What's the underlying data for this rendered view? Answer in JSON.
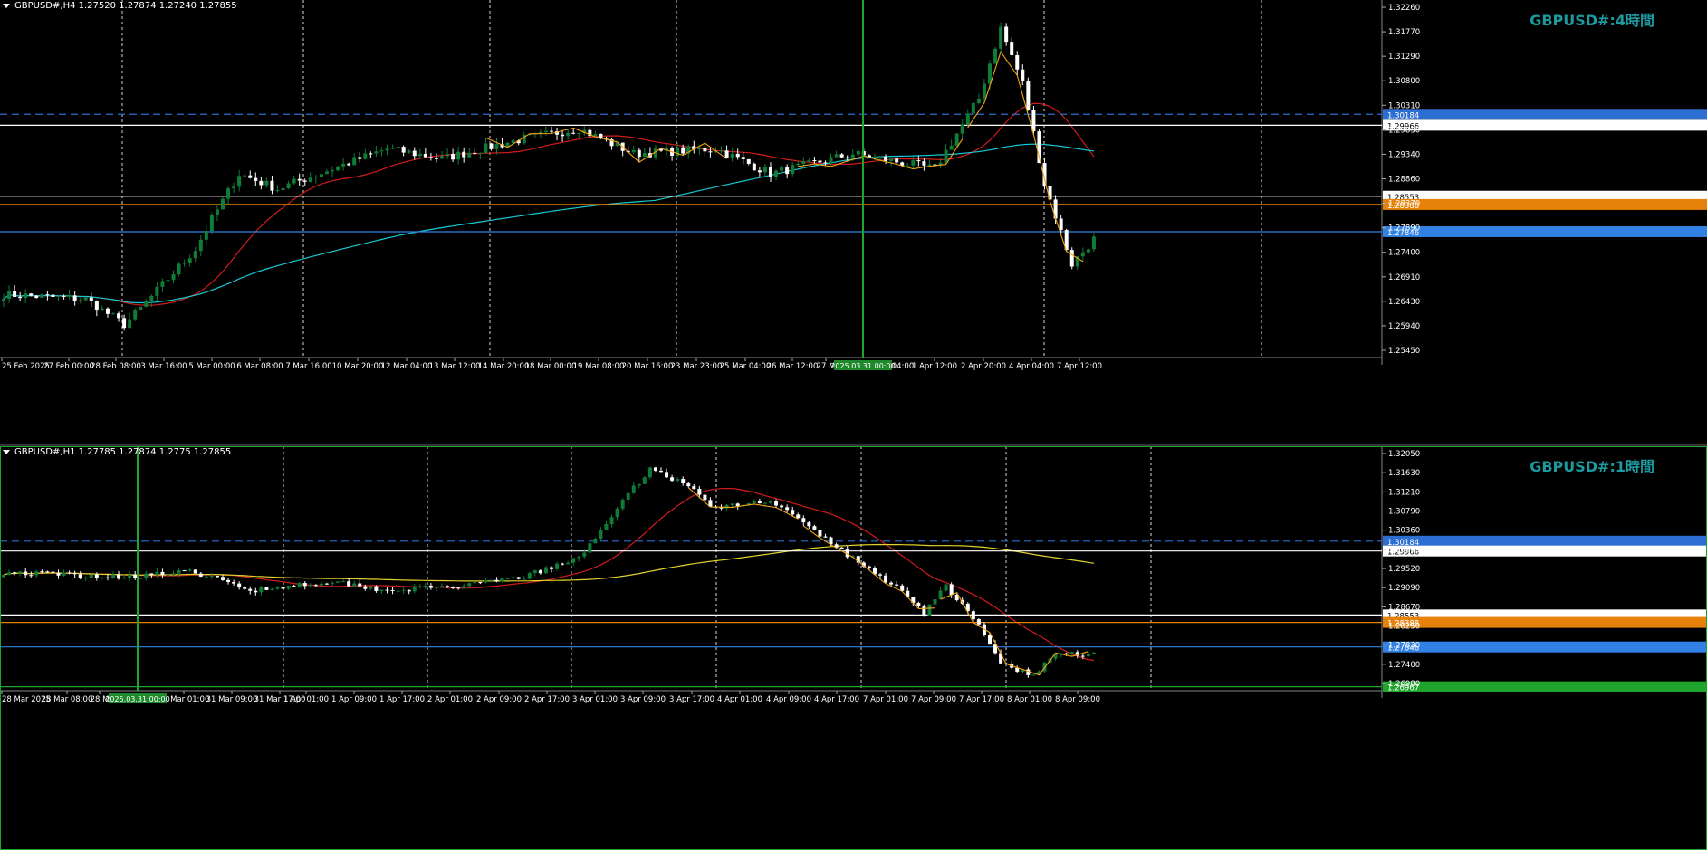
{
  "colors": {
    "background": "#000000",
    "bull": "#0f7d37",
    "bear": "#ffffff",
    "ma_red": "#d21c1c",
    "ma_cyan": "#17c8d2",
    "ma_yellow": "#e1d22d",
    "zigzag": "#f0a514",
    "grid": "#ffffff",
    "level_white": "#ffffff",
    "level_orange": "#e6820a",
    "level_blue": "#3282e6",
    "level_dashed": "#2d6ed2",
    "vline_green": "#1fa52b",
    "title": "#1c9aa0"
  },
  "panels": [
    {
      "id": "h4",
      "header": "GBPUSD#,H4  1.27520 1.27874 1.27240 1.27855",
      "title": "GBPUSD#:4時間",
      "price_labels": [
        "1.32260",
        "1.31770",
        "1.31290",
        "1.30800",
        "1.30310",
        "1.29830",
        "1.29340",
        "1.28860",
        "1.28370",
        "1.27890",
        "1.27400",
        "1.26910",
        "1.26430",
        "1.25940",
        "1.25450"
      ],
      "levels": [
        {
          "price": 1.30184,
          "label": "1.30184",
          "style": "dashed",
          "color": "#2d6ed2",
          "tag_bg": "#2d6ed2"
        },
        {
          "price": 1.29966,
          "label": "1.29966",
          "style": "solid",
          "color": "#ffffff",
          "tag_bg": "#ffffff"
        },
        {
          "price": 1.28553,
          "label": "1.28553",
          "style": "solid",
          "color": "#ffffff",
          "tag_bg": "#ffffff"
        },
        {
          "price": 1.28388,
          "label": "1.28388",
          "style": "solid",
          "color": "#e6820a",
          "tag_bg": "#e6820a"
        },
        {
          "price": 1.27846,
          "label": "1.27846",
          "style": "solid",
          "color": "#3282e6",
          "tag_bg": "#3282e6"
        }
      ],
      "time_labels": [
        "25 Feb 2025",
        "27 Feb 00:00",
        "28 Feb 08:00",
        "3 Mar 16:00",
        "5 Mar 00:00",
        "6 Mar 08:00",
        "7 Mar 16:00",
        "10 Mar 20:00",
        "12 Mar 04:00",
        "13 Mar 12:00",
        "14 Mar 20:00",
        "18 Mar 00:00",
        "19 Mar 08:00",
        "20 Mar 16:00",
        "23 Mar 23:00",
        "25 Mar 04:00",
        "26 Mar 12:00",
        "27 M",
        "1 Apr 12:00",
        "2 Apr 20:00",
        "4 Apr 04:00",
        "7 Apr 12:00"
      ],
      "cursor_label": "2025.03.31 00:00",
      "cursor_tail": "04:00"
    },
    {
      "id": "h1",
      "header": "GBPUSD#,H1  1.27785 1.27874 1.2775  1.27855",
      "title": "GBPUSD#:1時間",
      "price_labels": [
        "1.32050",
        "1.31630",
        "1.31210",
        "1.30790",
        "1.30360",
        "1.29940",
        "1.29520",
        "1.29090",
        "1.28670",
        "1.28250",
        "1.27830",
        "1.27400",
        "1.26980"
      ],
      "levels": [
        {
          "price": 1.30184,
          "label": "1.30184",
          "style": "dashed",
          "color": "#2d6ed2",
          "tag_bg": "#2d6ed2"
        },
        {
          "price": 1.29966,
          "label": "1.29966",
          "style": "solid",
          "color": "#ffffff",
          "tag_bg": "#ffffff"
        },
        {
          "price": 1.28553,
          "label": "1.28553",
          "style": "solid",
          "color": "#ffffff",
          "tag_bg": "#ffffff"
        },
        {
          "price": 1.28388,
          "label": "1.28388",
          "style": "solid",
          "color": "#e6820a",
          "tag_bg": "#e6820a"
        },
        {
          "price": 1.27846,
          "label": "1.27846",
          "style": "solid",
          "color": "#3282e6",
          "tag_bg": "#3282e6"
        },
        {
          "price": 1.26967,
          "label": "1.26967",
          "style": "solid",
          "color": "#1fa52b",
          "tag_bg": "#1fa52b"
        }
      ],
      "time_labels": [
        "28 Mar 2025",
        "28 Mar 08:00",
        "28 M",
        "31 Mar 01:00",
        "31 Mar 09:00",
        "31 Mar 17:00",
        "1 Apr 01:00",
        "1 Apr 09:00",
        "1 Apr 17:00",
        "2 Apr 01:00",
        "2 Apr 09:00",
        "2 Apr 17:00",
        "3 Apr 01:00",
        "3 Apr 09:00",
        "3 Apr 17:00",
        "4 Apr 01:00",
        "4 Apr 09:00",
        "4 Apr 17:00",
        "7 Apr 01:00",
        "7 Apr 09:00",
        "7 Apr 17:00",
        "8 Apr 01:00",
        "8 Apr 09:00"
      ],
      "cursor_label": "2025.03.31 00:00"
    }
  ]
}
